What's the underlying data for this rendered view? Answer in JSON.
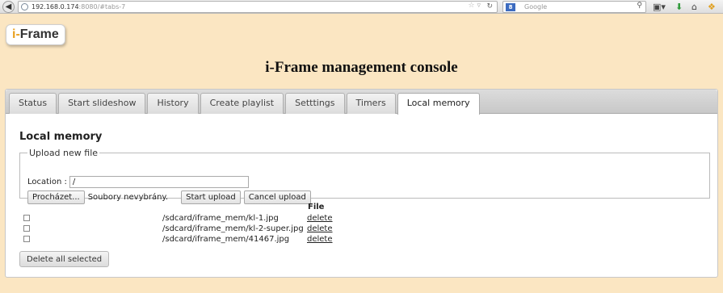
{
  "browser": {
    "url_host": "192.168.0.174",
    "url_path": ":8080/#tabs-7",
    "search_engine": "8",
    "search_placeholder": "Google"
  },
  "logo": {
    "prefix": "i-",
    "name": "Frame"
  },
  "page_title": "i-Frame management console",
  "tabs": [
    {
      "label": "Status"
    },
    {
      "label": "Start slideshow"
    },
    {
      "label": "History"
    },
    {
      "label": "Create playlist"
    },
    {
      "label": "Setttings"
    },
    {
      "label": "Timers"
    },
    {
      "label": "Local memory",
      "active": true
    }
  ],
  "section_title": "Local memory",
  "upload": {
    "legend": "Upload new file",
    "location_label": "Location :",
    "location_value": "/",
    "browse_label": "Procházet...",
    "no_file_text": "Soubory nevybrány.",
    "start_label": "Start upload",
    "cancel_label": "Cancel upload"
  },
  "file_column_header": "File",
  "files": [
    {
      "path": "/sdcard/iframe_mem/kl-1.jpg",
      "delete_label": "delete"
    },
    {
      "path": "/sdcard/iframe_mem/kl-2-super.jpg",
      "delete_label": "delete"
    },
    {
      "path": "/sdcard/iframe_mem/41467.jpg",
      "delete_label": "delete"
    }
  ],
  "delete_all_label": "Delete all selected",
  "colors": {
    "page_background": "#fbe6c2",
    "logo_accent": "#e8a020"
  }
}
